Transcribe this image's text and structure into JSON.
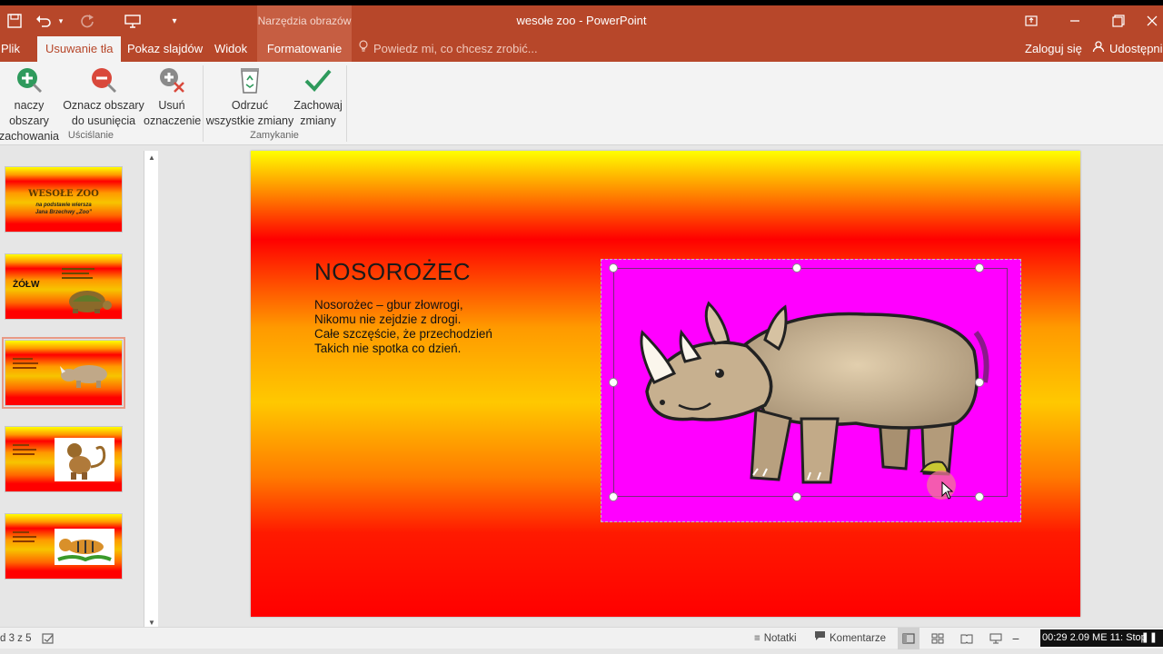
{
  "titlebar": {
    "document_title": "wesołe zoo - PowerPoint",
    "context_tab": "Narzędzia obrazów",
    "qat_icons": [
      "save-icon",
      "undo-icon",
      "redo-icon",
      "presentation-icon",
      "customize-qat-icon"
    ],
    "window_buttons": [
      "ribbon-display-icon",
      "minimize-icon",
      "restore-icon",
      "close-icon"
    ]
  },
  "tabs": {
    "file": "Plik",
    "background_removal": "Usuwanie tła",
    "slideshow": "Pokaz slajdów",
    "view": "Widok",
    "format": "Formatowanie",
    "tellme": "Powiedz mi, co chcesz zrobić...",
    "signin": "Zaloguj się",
    "share": "Udostępni"
  },
  "ribbon": {
    "mark_keep": [
      "naczy obszary",
      "zachowania"
    ],
    "mark_remove": [
      "Oznacz obszary",
      "do usunięcia"
    ],
    "delete_mark": [
      "Usuń",
      "oznaczenie"
    ],
    "discard": [
      "Odrzuć",
      "wszystkie zmiany"
    ],
    "keep_changes": [
      "Zachowaj",
      "zmiany"
    ],
    "group_refine": "Uściślanie",
    "group_close": "Zamykanie"
  },
  "thumbnails": [
    {
      "title": "WESOŁE ZOO",
      "sub": [
        "na podstawie wiersza",
        "Jana Brzechwy „Zoo”"
      ]
    },
    {
      "title": "ŻÓŁW"
    },
    {
      "title": "",
      "selected": true
    },
    {
      "title": ""
    },
    {
      "title": ""
    }
  ],
  "slide": {
    "heading": "NOSOROŻEC",
    "lines": [
      "Nosorożec – gbur złowrogi,",
      "Nikomu nie zejdzie z drogi.",
      "Całe szczęście, że przechodzień",
      "Takich nie spotka co dzień."
    ]
  },
  "statusbar": {
    "slide_counter": "d 3 z 5",
    "notes": "Notatki",
    "comments": "Komentarze",
    "recorder": "00:29 2.09 ME 11: Stop"
  },
  "colors": {
    "accent": "#b7472a",
    "picture_background": "#ff00ff"
  }
}
